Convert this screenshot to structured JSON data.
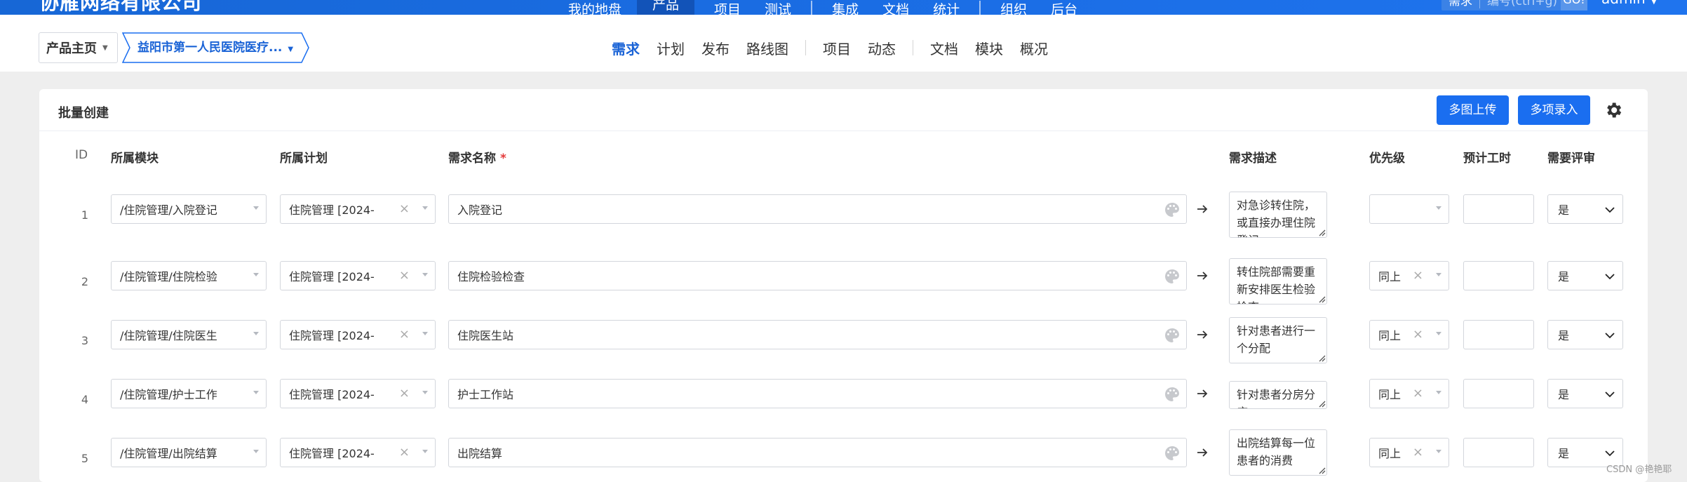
{
  "header": {
    "company": "协雁网络有限公司",
    "nav": [
      "我的地盘",
      "产品",
      "项目",
      "测试",
      "集成",
      "文档",
      "统计",
      "组织",
      "后台"
    ],
    "active_nav": "产品",
    "search": {
      "type": "需求",
      "placeholder": "编号(ctrl+g)",
      "go": "GO!"
    },
    "user": "admin"
  },
  "subnav": {
    "product_home": "产品主页",
    "current_product": "益阳市第一人民医院医疗...",
    "tabs": [
      "需求",
      "计划",
      "发布",
      "路线图",
      "项目",
      "动态",
      "文档",
      "模块",
      "概况"
    ],
    "active_tab": "需求"
  },
  "panel": {
    "title": "批量创建",
    "buttons": {
      "multi_upload": "多图上传",
      "multi_input": "多项录入"
    }
  },
  "table": {
    "columns": {
      "id": "ID",
      "module": "所属模块",
      "plan": "所属计划",
      "name": "需求名称",
      "required_mark": "*",
      "desc": "需求描述",
      "priority": "优先级",
      "estimate": "预计工时",
      "review": "需要评审"
    },
    "rows": [
      {
        "id": "1",
        "module": "/住院管理/入院登记",
        "plan": "住院管理 [2024-",
        "name": "入院登记",
        "desc": "对急诊转住院，或直接办理住院登记",
        "priority": "",
        "estimate": "",
        "review": "是"
      },
      {
        "id": "2",
        "module": "/住院管理/住院检验",
        "plan": "住院管理 [2024-",
        "name": "住院检验检查",
        "desc": "转住院部需要重新安排医生检验检查",
        "priority": "同上",
        "estimate": "",
        "review": "是"
      },
      {
        "id": "3",
        "module": "/住院管理/住院医生",
        "plan": "住院管理 [2024-",
        "name": "住院医生站",
        "desc": "针对患者进行一个分配",
        "priority": "同上",
        "estimate": "",
        "review": "是"
      },
      {
        "id": "4",
        "module": "/住院管理/护士工作",
        "plan": "住院管理 [2024-",
        "name": "护士工作站",
        "desc": "针对患者分房分床",
        "priority": "同上",
        "estimate": "",
        "review": "是"
      },
      {
        "id": "5",
        "module": "/住院管理/出院结算",
        "plan": "住院管理 [2024-",
        "name": "出院结算",
        "desc": "出院结算每一位患者的消费",
        "priority": "同上",
        "estimate": "",
        "review": "是"
      }
    ]
  },
  "watermark": "CSDN @艳艳耶",
  "colors": {
    "brand": "#1a6ef0",
    "header": "#1767d6",
    "required": "#e43b3b"
  }
}
